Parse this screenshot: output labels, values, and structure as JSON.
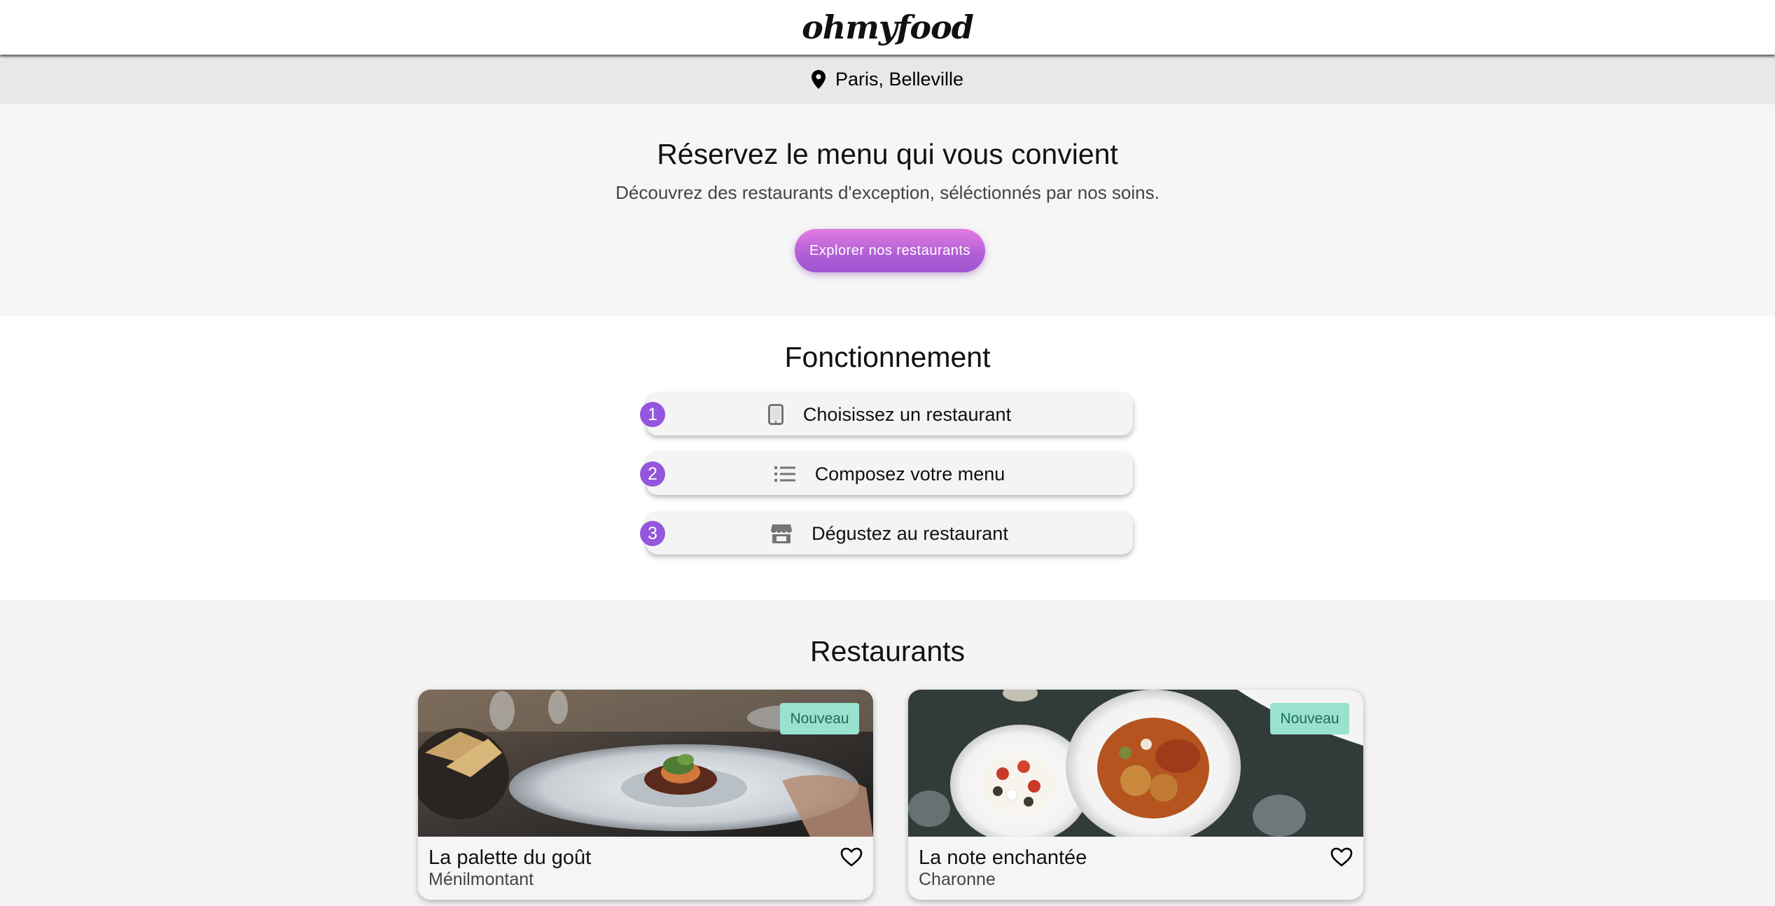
{
  "header": {
    "logo": "ohmyfood"
  },
  "location": {
    "icon": "map-pin-icon",
    "text": "Paris, Belleville"
  },
  "hero": {
    "title": "Réservez le menu qui vous convient",
    "subtitle": "Découvrez des restaurants d'exception, séléctionnés par nos soins.",
    "cta_label": "Explorer nos restaurants"
  },
  "how": {
    "title": "Fonctionnement",
    "steps": [
      {
        "number": "1",
        "icon": "smartphone-icon",
        "label": "Choisissez un restaurant"
      },
      {
        "number": "2",
        "icon": "list-icon",
        "label": "Composez votre menu"
      },
      {
        "number": "3",
        "icon": "store-icon",
        "label": "Dégustez au restaurant"
      }
    ]
  },
  "restaurants": {
    "title": "Restaurants",
    "cards": [
      {
        "badge": "Nouveau",
        "name": "La palette du goût",
        "area": "Ménilmontant",
        "icon": "heart-icon"
      },
      {
        "badge": "Nouveau",
        "name": "La note enchantée",
        "area": "Charonne",
        "icon": "heart-icon"
      }
    ]
  },
  "colors": {
    "accent_gradient_start": "#e27ce0",
    "accent_gradient_end": "#9f55d2",
    "step_number_bg": "#9356dc",
    "badge_bg": "#99e2cf",
    "badge_text": "#1f6b59"
  }
}
